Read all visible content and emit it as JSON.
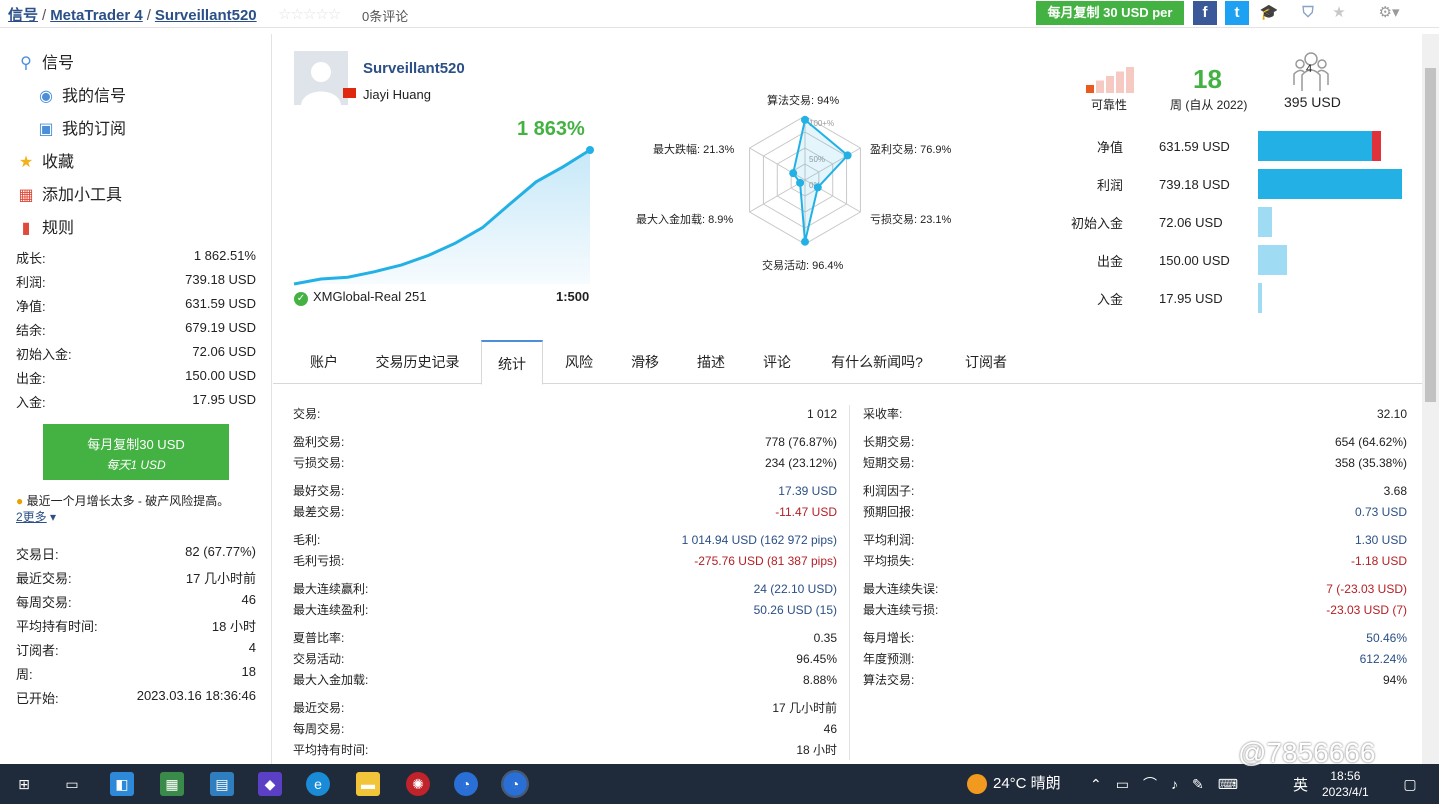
{
  "breadcrumb": {
    "items": [
      "信号",
      "MetaTrader 4",
      "Surveillant520"
    ],
    "separator": "/"
  },
  "rating": {
    "stars": "☆☆☆☆☆",
    "reviews": "0条评论"
  },
  "header": {
    "copy_button": "每月复制 30 USD per",
    "facebook": "f",
    "twitter": "t"
  },
  "sidebar": {
    "menu": [
      {
        "label": "信号",
        "icon": "antenna-icon"
      },
      {
        "label": "我的信号",
        "icon": "signal-icon"
      },
      {
        "label": "我的订阅",
        "icon": "subscription-icon"
      },
      {
        "label": "收藏",
        "icon": "star-icon"
      },
      {
        "label": "添加小工具",
        "icon": "widget-icon"
      },
      {
        "label": "规则",
        "icon": "bookmark-icon"
      }
    ],
    "stats": [
      {
        "label": "成长:",
        "value": "1 862.51%"
      },
      {
        "label": "利润:",
        "value": "739.18 USD"
      },
      {
        "label": "净值:",
        "value": "631.59 USD"
      },
      {
        "label": "结余:",
        "value": "679.19 USD"
      },
      {
        "label": "初始入金:",
        "value": "72.06 USD"
      },
      {
        "label": "出金:",
        "value": "150.00 USD"
      },
      {
        "label": "入金:",
        "value": "17.95 USD"
      }
    ],
    "copy": {
      "line1": "每月复制30 USD",
      "line2": "每天1 USD"
    },
    "warning": {
      "text": "最近一个月增长太多 - 破产风险提高。",
      "more": "2更多"
    },
    "info": [
      {
        "label": "交易日:",
        "value": "82 (67.77%)"
      },
      {
        "label": "最近交易:",
        "value": "17 几小时前"
      },
      {
        "label": "每周交易:",
        "value": "46"
      },
      {
        "label": "平均持有时间:",
        "value": "18 小时"
      },
      {
        "label": "订阅者:",
        "value": "4"
      },
      {
        "label": "周:",
        "value": "18"
      },
      {
        "label": "已开始:",
        "value": "2023.03.16 18:36:46"
      }
    ]
  },
  "profile": {
    "name": "Surveillant520",
    "real_name": "Jiayi Huang",
    "growth": "1 863%",
    "server": "XMGlobal-Real 251",
    "leverage": "1:500",
    "growth_curve": [
      0,
      1.1,
      1.5,
      2.7,
      4.2,
      6.3,
      9.0,
      12.4,
      17.5,
      22.5,
      25.8,
      29.5
    ]
  },
  "radar": {
    "labels": {
      "algo": "算法交易: 94%",
      "profit": "盈利交易: 76.9%",
      "loss": "亏损交易: 23.1%",
      "activity": "交易活动: 96.4%",
      "deposit_load": "最大入金加载: 8.9%",
      "drawdown": "最大跌幅: 21.3%"
    },
    "ticks": [
      "100+%",
      "50%",
      "0%"
    ],
    "values": [
      94,
      76.9,
      23.1,
      96.4,
      8.9,
      21.3
    ]
  },
  "reliability": {
    "label": "可靠性",
    "level": 1,
    "max": 5
  },
  "weeks": {
    "value": "18",
    "label": "周 (自从 2022)"
  },
  "subscribers": {
    "count": "4",
    "amount": "395 USD"
  },
  "equity": [
    {
      "label": "净值",
      "value": "631.59 USD",
      "amount": 631.59
    },
    {
      "label": "利润",
      "value": "739.18 USD",
      "amount": 739.18
    },
    {
      "label": "初始入金",
      "value": "72.06 USD",
      "amount": 72.06
    },
    {
      "label": "出金",
      "value": "150.00 USD",
      "amount": 150.0
    },
    {
      "label": "入金",
      "value": "17.95 USD",
      "amount": 17.95
    }
  ],
  "tabs": [
    "账户",
    "交易历史记录",
    "统计",
    "风险",
    "滑移",
    "描述",
    "评论",
    "有什么新闻吗?",
    "订阅者"
  ],
  "active_tab": "统计",
  "stats_left": [
    {
      "label": "交易:",
      "value": "1 012"
    },
    {
      "label": "盈利交易:",
      "value": "778 (76.87%)"
    },
    {
      "label": "亏损交易:",
      "value": "234 (23.12%)"
    },
    {
      "label": "最好交易:",
      "value": "17.39 USD"
    },
    {
      "label": "最差交易:",
      "value": "-11.47 USD"
    },
    {
      "label": "毛利:",
      "value": "1 014.94 USD (162 972 pips)"
    },
    {
      "label": "毛利亏损:",
      "value": "-275.76 USD (81 387 pips)"
    },
    {
      "label": "最大连续赢利:",
      "value": "24 (22.10 USD)"
    },
    {
      "label": "最大连续盈利:",
      "value": "50.26 USD (15)"
    },
    {
      "label": "夏普比率:",
      "value": "0.35"
    },
    {
      "label": "交易活动:",
      "value": "96.45%"
    },
    {
      "label": "最大入金加载:",
      "value": "8.88%"
    },
    {
      "label": "最近交易:",
      "value": "17 几小时前"
    },
    {
      "label": "每周交易:",
      "value": "46"
    },
    {
      "label": "平均持有时间:",
      "value": "18 小时"
    }
  ],
  "stats_right": [
    {
      "label": "采收率:",
      "value": "32.10"
    },
    {
      "label": "长期交易:",
      "value": "654 (64.62%)"
    },
    {
      "label": "短期交易:",
      "value": "358 (35.38%)"
    },
    {
      "label": "利润因子:",
      "value": "3.68"
    },
    {
      "label": "预期回报:",
      "value": "0.73 USD"
    },
    {
      "label": "平均利润:",
      "value": "1.30 USD"
    },
    {
      "label": "平均损失:",
      "value": "-1.18 USD"
    },
    {
      "label": "最大连续失误:",
      "value": "7 (-23.03 USD)"
    },
    {
      "label": "最大连续亏损:",
      "value": "-23.03 USD (7)"
    },
    {
      "label": "每月增长:",
      "value": "50.46%"
    },
    {
      "label": "年度预测:",
      "value": "612.24%"
    },
    {
      "label": "算法交易:",
      "value": "94%"
    }
  ],
  "colors": {
    "accent": "#44b243",
    "link": "#2b4f86",
    "chart": "#23b1e5",
    "negative": "#b52025"
  },
  "taskbar": {
    "weather": "24°C 晴朗",
    "ime": "英",
    "time": "18:56",
    "date": "2023/4/1",
    "watermark": "@7856666"
  }
}
